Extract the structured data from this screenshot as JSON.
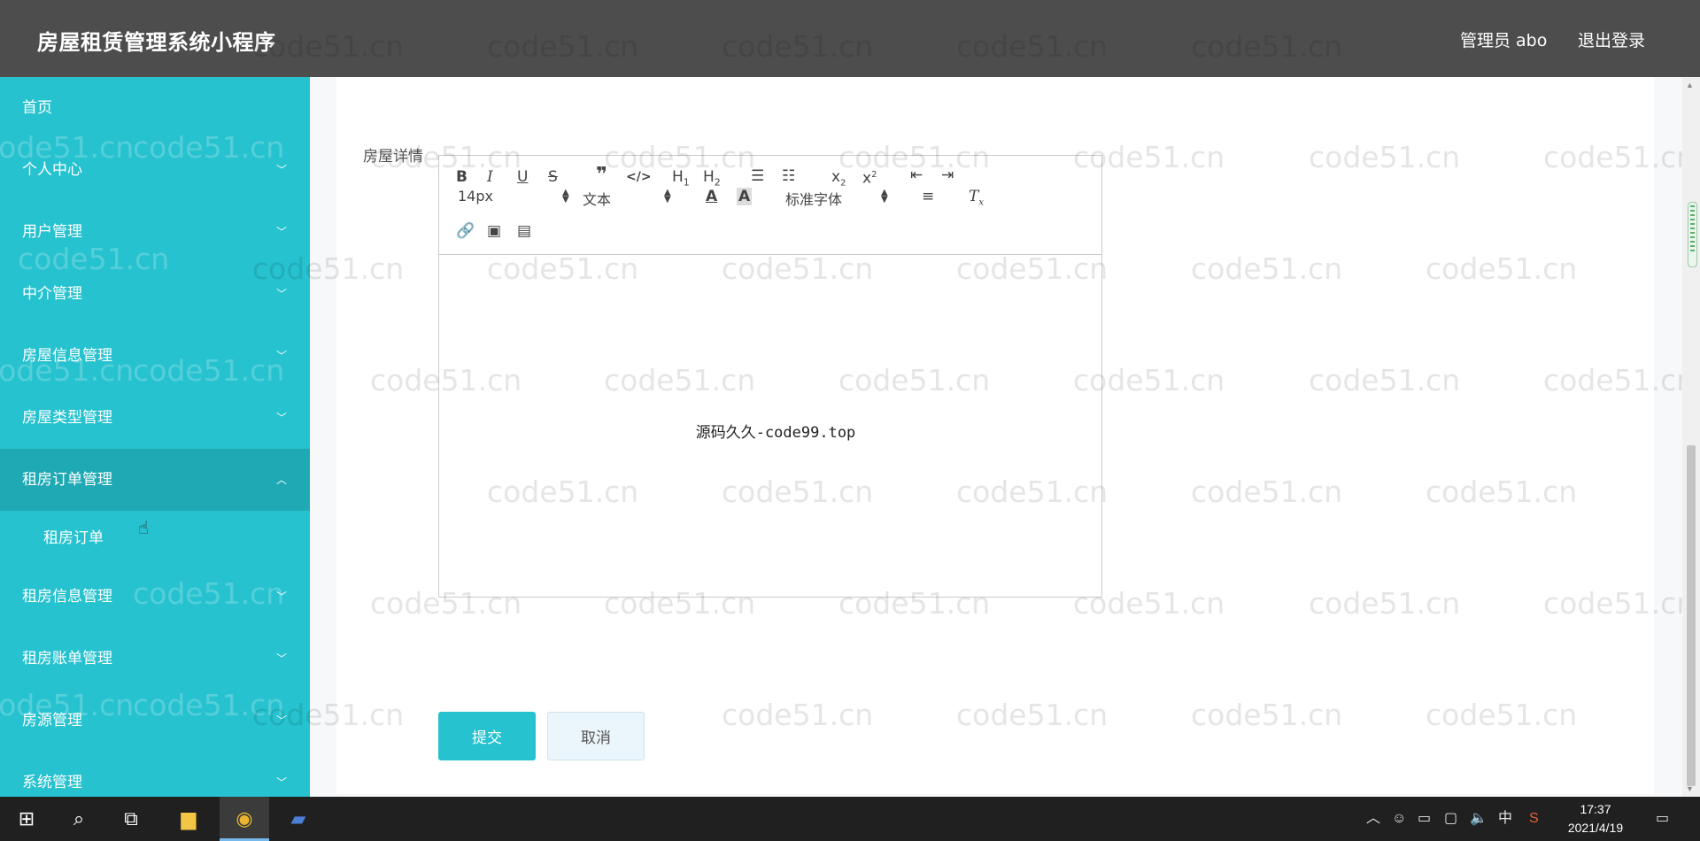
{
  "header": {
    "title": "房屋租赁管理系统小程序",
    "admin_label": "管理员 abo",
    "logout_label": "退出登录"
  },
  "sidebar": {
    "items": [
      {
        "label": "首页",
        "has_chevron": false
      },
      {
        "label": "个人中心",
        "has_chevron": true
      },
      {
        "label": "用户管理",
        "has_chevron": true
      },
      {
        "label": "中介管理",
        "has_chevron": true
      },
      {
        "label": "房屋信息管理",
        "has_chevron": true
      },
      {
        "label": "房屋类型管理",
        "has_chevron": true
      },
      {
        "label": "租房订单管理",
        "has_chevron": true,
        "expanded": true,
        "children": [
          {
            "label": "租房订单"
          }
        ]
      },
      {
        "label": "租房信息管理",
        "has_chevron": true
      },
      {
        "label": "租房账单管理",
        "has_chevron": true
      },
      {
        "label": "房源管理",
        "has_chevron": true
      },
      {
        "label": "系统管理",
        "has_chevron": true
      }
    ]
  },
  "form": {
    "field_label": "房屋详情",
    "editor": {
      "font_size": "14px",
      "text_type": "文本",
      "font_family": "标准字体",
      "content": "源码久久-code99.top"
    },
    "submit_label": "提交",
    "cancel_label": "取消"
  },
  "watermark": "code51.cn",
  "taskbar": {
    "time": "17:37",
    "date": "2021/4/19",
    "ime": "中"
  },
  "colors": {
    "header_bg": "#4d4d4d",
    "sidebar_bg": "#26c2cf",
    "sidebar_active_bg": "#1fa9b4",
    "primary_button": "#26c2cf"
  }
}
